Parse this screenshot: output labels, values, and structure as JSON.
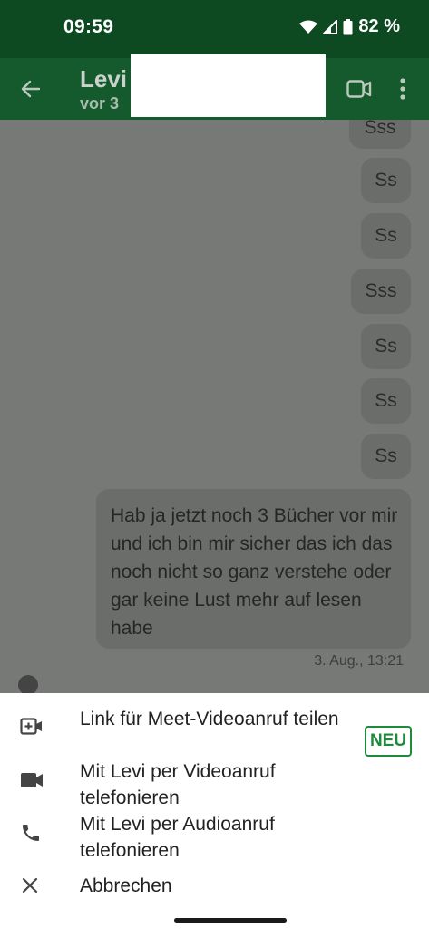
{
  "status_bar": {
    "time": "09:59",
    "battery": "82 %",
    "icons": [
      "wifi-icon",
      "signal-icon",
      "battery-icon"
    ]
  },
  "app_bar": {
    "contact_name": "Levi",
    "contact_status": "vor 3",
    "icons": [
      "back-arrow-icon",
      "video-call-icon",
      "more-vert-icon"
    ]
  },
  "chat": {
    "messages": [
      "Sss",
      "Ss",
      "Ss",
      "Sss",
      "Ss",
      "Ss",
      "Ss"
    ],
    "long_message": "Hab ja jetzt noch 3 Bücher vor mir und ich bin mir sicher das ich das noch nicht so ganz verstehe oder gar keine Lust mehr auf lesen habe",
    "timestamp": "3. Aug., 13:21"
  },
  "sheet": {
    "items": [
      {
        "label": "Link für Meet-Videoanruf teilen",
        "icon": "add-video-link-icon",
        "badge": "NEU"
      },
      {
        "label": "Mit Levi per Videoanruf telefonieren",
        "icon": "videocam-icon"
      },
      {
        "label": "Mit Levi per Audioanruf telefonieren",
        "icon": "phone-icon"
      },
      {
        "label": "Abbrechen",
        "icon": "close-icon"
      }
    ]
  },
  "colors": {
    "status_bar_bg": "#0d4a22",
    "app_bar_bg": "#145a2c",
    "scrim": "#777977",
    "accent_green": "#1e8a3c"
  }
}
